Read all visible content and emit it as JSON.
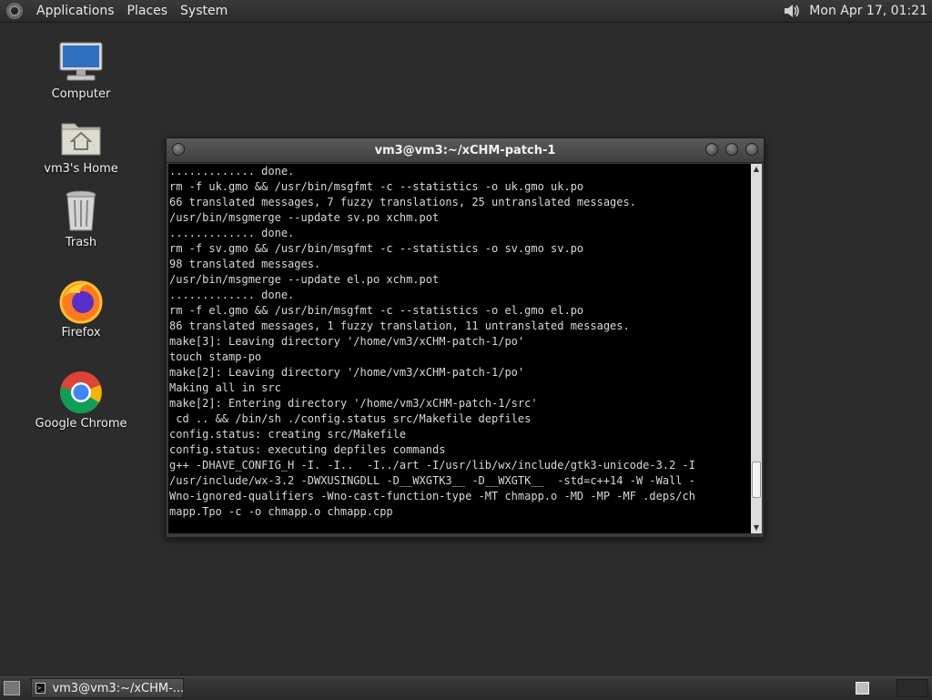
{
  "top_panel": {
    "menus": [
      "Applications",
      "Places",
      "System"
    ],
    "clock": "Mon Apr 17, 01:21",
    "icons": {
      "menu_logo": "gnome-foot-icon",
      "volume": "speaker-volume-icon"
    }
  },
  "desktop": {
    "icons": [
      {
        "label": "Computer",
        "icon": "monitor-icon"
      },
      {
        "label": "vm3's Home",
        "icon": "home-folder-icon"
      },
      {
        "label": "Trash",
        "icon": "trash-icon"
      },
      {
        "label": "Firefox",
        "icon": "firefox-icon"
      },
      {
        "label": "Google Chrome",
        "icon": "chrome-icon"
      }
    ]
  },
  "terminal": {
    "title": "vm3@vm3:~/xCHM-patch-1",
    "lines": [
      "............. done.",
      "rm -f uk.gmo && /usr/bin/msgfmt -c --statistics -o uk.gmo uk.po",
      "66 translated messages, 7 fuzzy translations, 25 untranslated messages.",
      "/usr/bin/msgmerge --update sv.po xchm.pot",
      "............. done.",
      "rm -f sv.gmo && /usr/bin/msgfmt -c --statistics -o sv.gmo sv.po",
      "98 translated messages.",
      "/usr/bin/msgmerge --update el.po xchm.pot",
      "............. done.",
      "rm -f el.gmo && /usr/bin/msgfmt -c --statistics -o el.gmo el.po",
      "86 translated messages, 1 fuzzy translation, 11 untranslated messages.",
      "make[3]: Leaving directory '/home/vm3/xCHM-patch-1/po'",
      "touch stamp-po",
      "make[2]: Leaving directory '/home/vm3/xCHM-patch-1/po'",
      "Making all in src",
      "make[2]: Entering directory '/home/vm3/xCHM-patch-1/src'",
      " cd .. && /bin/sh ./config.status src/Makefile depfiles",
      "config.status: creating src/Makefile",
      "config.status: executing depfiles commands",
      "g++ -DHAVE_CONFIG_H -I. -I..  -I../art -I/usr/lib/wx/include/gtk3-unicode-3.2 -I",
      "/usr/include/wx-3.2 -DWXUSINGDLL -D__WXGTK3__ -D__WXGTK__  -std=c++14 -W -Wall -",
      "Wno-ignored-qualifiers -Wno-cast-function-type -MT chmapp.o -MD -MP -MF .deps/ch",
      "mapp.Tpo -c -o chmapp.o chmapp.cpp"
    ],
    "scroll_position": 0.92
  },
  "bottom_panel": {
    "task_label": "vm3@vm3:~/xCHM-...",
    "icons": {
      "show_desktop": "show-desktop-icon",
      "task": "terminal-icon",
      "workspace": "workspace-switcher-icon"
    }
  }
}
